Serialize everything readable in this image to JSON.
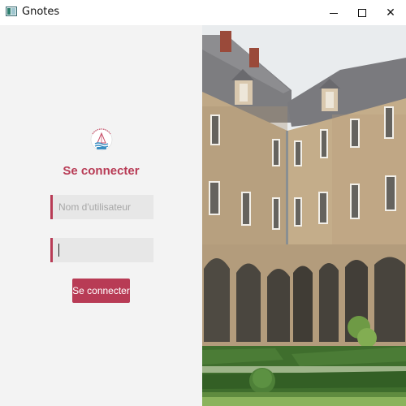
{
  "window": {
    "title": "Gnotes",
    "icon": "app-icon",
    "controls": {
      "minimize": "minimize-icon",
      "maximize": "maximize-icon",
      "close": "✕"
    }
  },
  "login": {
    "logo": "logo-icon",
    "title": "Se connecter",
    "username": {
      "placeholder": "Nom d'utilisateur",
      "value": ""
    },
    "password": {
      "placeholder": "",
      "value": ""
    },
    "submit_label": "Se connecter"
  },
  "colors": {
    "accent": "#b83b55",
    "panel_background": "#f3f3f3",
    "field_background": "#e7e7e7"
  },
  "image": {
    "subject": "cloister-courtyard-photo"
  }
}
